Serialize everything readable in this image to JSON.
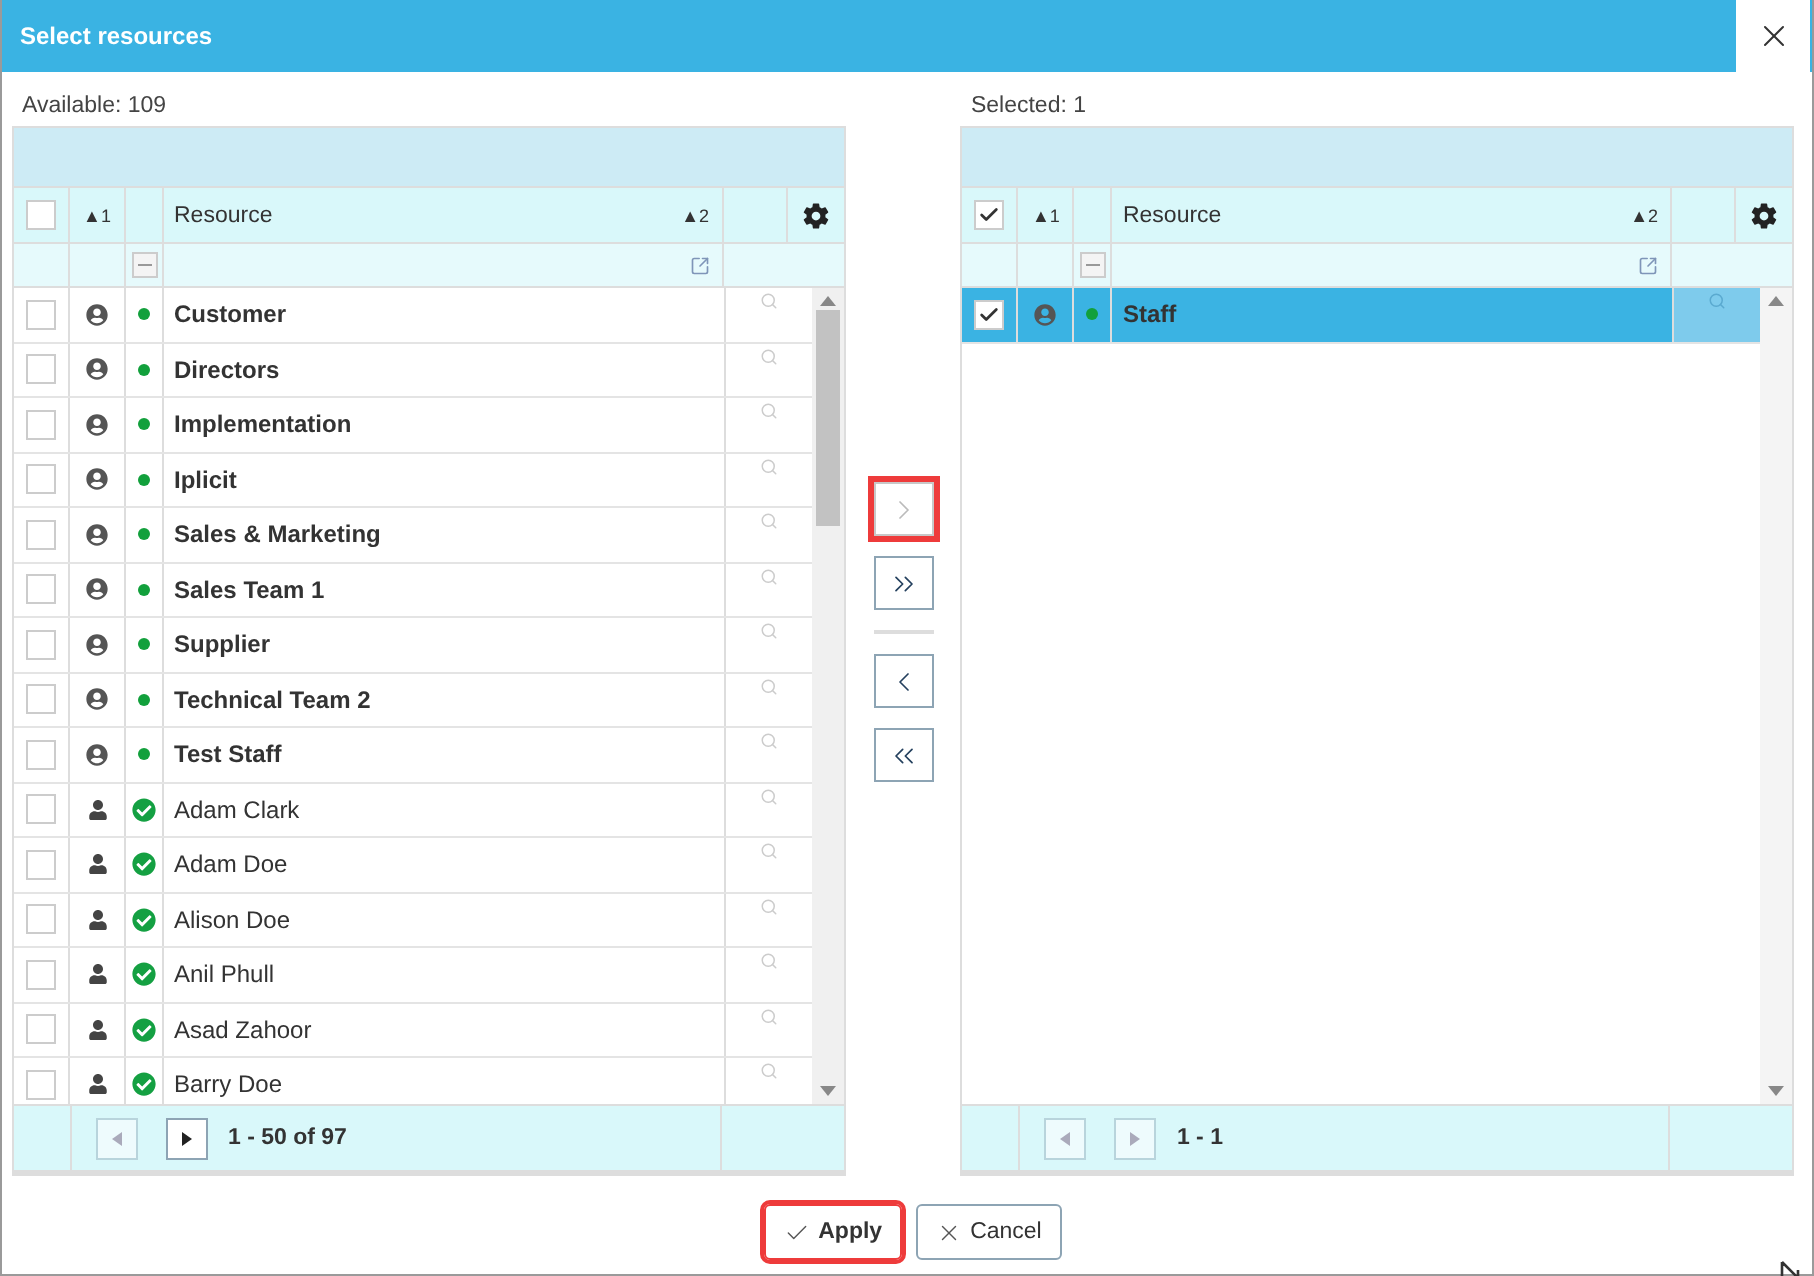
{
  "dialog": {
    "title": "Select resources"
  },
  "panels": [
    {
      "label": "Available: 109",
      "header": {
        "checked": false,
        "sort_a": "▲1",
        "column": "Resource",
        "sort_b": "▲2"
      },
      "scroll_thumb": true,
      "rows": [
        {
          "name": "Customer",
          "kind": "group",
          "checked": false,
          "selected": false
        },
        {
          "name": "Directors",
          "kind": "group",
          "checked": false,
          "selected": false
        },
        {
          "name": "Implementation",
          "kind": "group",
          "checked": false,
          "selected": false
        },
        {
          "name": "Iplicit",
          "kind": "group",
          "checked": false,
          "selected": false
        },
        {
          "name": "Sales & Marketing",
          "kind": "group",
          "checked": false,
          "selected": false
        },
        {
          "name": "Sales Team 1",
          "kind": "group",
          "checked": false,
          "selected": false
        },
        {
          "name": "Supplier",
          "kind": "group",
          "checked": false,
          "selected": false
        },
        {
          "name": "Technical Team 2",
          "kind": "group",
          "checked": false,
          "selected": false
        },
        {
          "name": "Test Staff",
          "kind": "group",
          "checked": false,
          "selected": false
        },
        {
          "name": "Adam Clark",
          "kind": "person",
          "checked": false,
          "selected": false
        },
        {
          "name": "Adam Doe",
          "kind": "person",
          "checked": false,
          "selected": false
        },
        {
          "name": "Alison Doe",
          "kind": "person",
          "checked": false,
          "selected": false
        },
        {
          "name": "Anil Phull",
          "kind": "person",
          "checked": false,
          "selected": false
        },
        {
          "name": "Asad Zahoor",
          "kind": "person",
          "checked": false,
          "selected": false
        },
        {
          "name": "Barry Doe",
          "kind": "person",
          "checked": false,
          "selected": false
        }
      ],
      "pager": {
        "prev_disabled": true,
        "next_disabled": false,
        "range": "1 - 50 of 97"
      }
    },
    {
      "label": "Selected: 1",
      "header": {
        "checked": true,
        "sort_a": "▲1",
        "column": "Resource",
        "sort_b": "▲2"
      },
      "scroll_thumb": false,
      "rows": [
        {
          "name": "Staff",
          "kind": "group",
          "checked": true,
          "selected": true
        }
      ],
      "pager": {
        "prev_disabled": true,
        "next_disabled": true,
        "range": "1 - 1"
      }
    }
  ],
  "transfer_buttons": [
    {
      "kind": "move-one",
      "disabled": true,
      "highlighted": true
    },
    {
      "kind": "move-all",
      "disabled": false,
      "highlighted": false
    },
    {
      "kind": "divider"
    },
    {
      "kind": "remove-one",
      "disabled": false,
      "highlighted": false
    },
    {
      "kind": "remove-all",
      "disabled": false,
      "highlighted": false
    }
  ],
  "actions": [
    {
      "kind": "apply",
      "label": "Apply",
      "highlighted": true
    },
    {
      "kind": "cancel",
      "label": "Cancel",
      "highlighted": false
    }
  ]
}
